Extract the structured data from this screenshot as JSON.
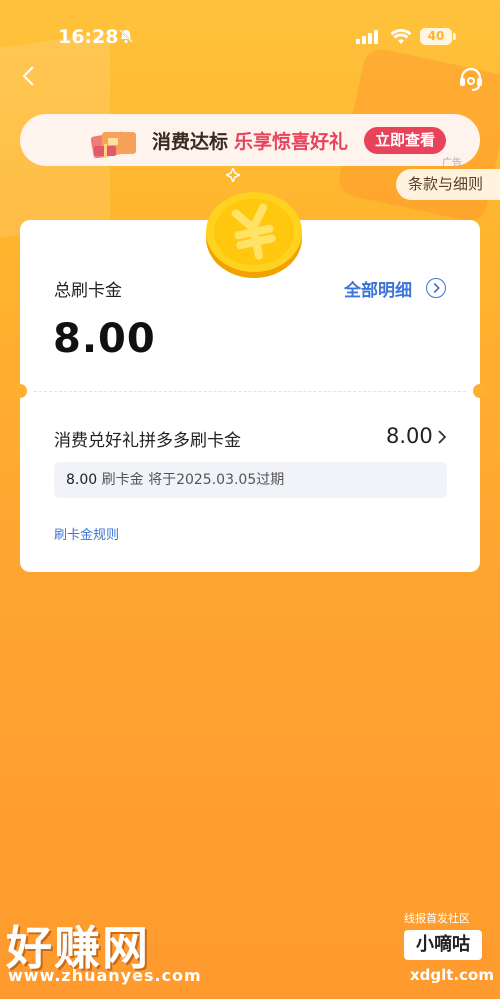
{
  "status_bar": {
    "time": "16:28",
    "battery": "40",
    "icons": [
      "bell-off-icon",
      "signal-icon",
      "wifi-icon",
      "battery-icon"
    ]
  },
  "nav": {
    "icons": [
      "back-arrow-icon",
      "customer-service-icon"
    ]
  },
  "banner": {
    "text_main": "消费达标",
    "text_highlight": "乐享惊喜好礼",
    "button_label": "立即查看",
    "ad_label": "广告",
    "highlight_color": "#E8435A"
  },
  "terms_label": "条款与细则",
  "card": {
    "total_label": "总刷卡金",
    "total_amount": "8.00",
    "detail_link": "全部明细",
    "item": {
      "title": "消费兑好礼拼多多刷卡金",
      "amount": "8.00",
      "expire_amount": "8.00",
      "expire_unit": "刷卡金",
      "expire_text": "将于2025.03.05过期"
    },
    "rules_link": "刷卡金规则",
    "link_color": "#3C74D8"
  },
  "watermark": {
    "left_title": "好赚网",
    "left_url": "www.zhuanyes.com",
    "right_top": "线报首发社区",
    "right_name": "小嘀咕",
    "right_url": "xdglt.com"
  }
}
